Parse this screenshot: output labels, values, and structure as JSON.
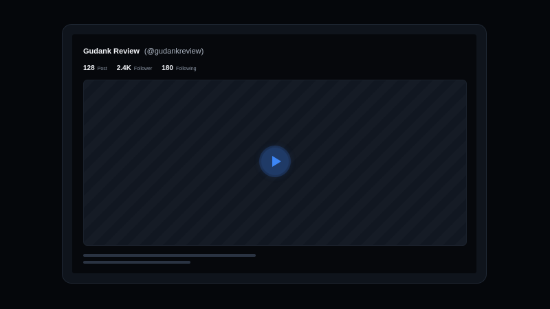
{
  "profile": {
    "name": "Gudank Review",
    "handle": "(@gudankreview)"
  },
  "stats": [
    {
      "value": "128",
      "label": "Post"
    },
    {
      "value": "2.4K",
      "label": "Follower"
    },
    {
      "value": "180",
      "label": "Following"
    }
  ],
  "video": {
    "play_icon": "play-icon"
  },
  "colors": {
    "background": "#05070b",
    "accent": "#3d86f5",
    "play_circle": "#1f3a66"
  }
}
